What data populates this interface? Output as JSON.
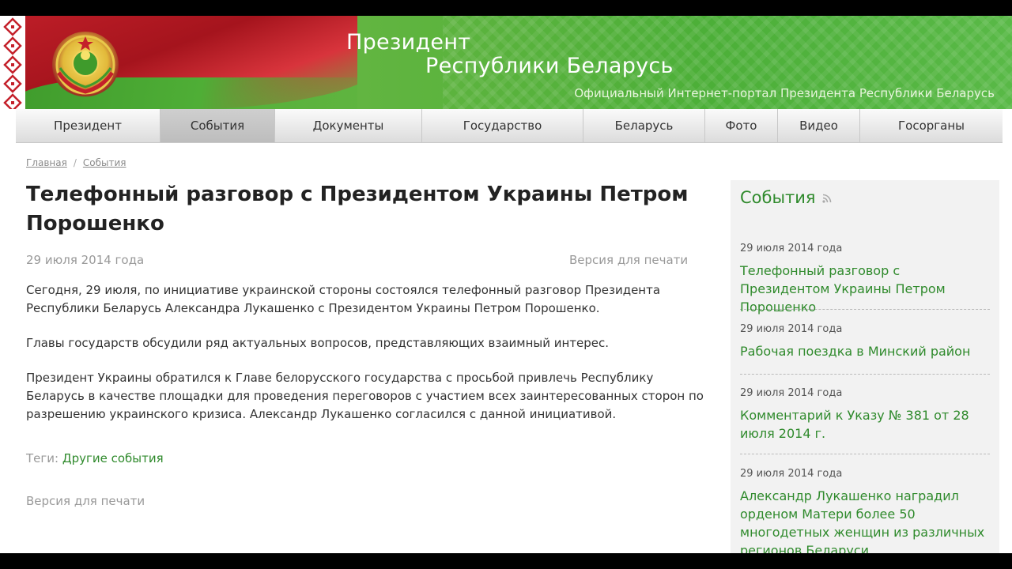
{
  "header": {
    "title_line1": "Президент",
    "title_line2": "Республики Беларусь",
    "subtitle": "Официальный Интернет-портал Президента Республики Беларусь"
  },
  "nav": {
    "items": [
      {
        "label": "Президент",
        "active": false
      },
      {
        "label": "События",
        "active": true
      },
      {
        "label": "Документы",
        "active": false
      },
      {
        "label": "Государство",
        "active": false
      },
      {
        "label": "Беларусь",
        "active": false
      },
      {
        "label": "Фото",
        "active": false
      },
      {
        "label": "Видео",
        "active": false
      },
      {
        "label": "Госорганы",
        "active": false
      }
    ]
  },
  "breadcrumb": {
    "home": "Главная",
    "separator": "/",
    "current": "События"
  },
  "article": {
    "title": "Телефонный разговор с Президентом Украины Петром Порошенко",
    "date": "29 июля 2014 года",
    "print_label": "Версия для печати",
    "paragraphs": [
      "Сегодня, 29 июля, по инициативе украинской стороны состоялся телефонный разговор Президента Республики Беларусь Александра Лукашенко с Президентом Украины Петром Порошенко.",
      "Главы государств обсудили ряд актуальных вопросов, представляющих взаимный интерес.",
      "Президент Украины обратился к Главе белорусского государства с просьбой привлечь Республику Беларусь в качестве площадки для проведения переговоров с участием всех заинтересованных сторон по разрешению украинского кризиса. Александр Лукашенко согласился с данной инициативой."
    ],
    "tags_label": "Теги:",
    "tag": "Другие события",
    "print_bottom": "Версия для печати"
  },
  "sidebar": {
    "title": "События",
    "items": [
      {
        "date": "29 июля 2014 года",
        "title": "Телефонный разговор с Президентом Украины Петром Порошенко"
      },
      {
        "date": "29 июля 2014 года",
        "title": "Рабочая поездка в Минский район"
      },
      {
        "date": "29 июля 2014 года",
        "title": "Комментарий к Указу № 381 от 28 июля 2014 г."
      },
      {
        "date": "29 июля 2014 года",
        "title": "Александр Лукашенко наградил орденом Матери более 50 многодетных женщин из различных регионов Беларуси"
      }
    ]
  },
  "colors": {
    "accent_green": "#2f8a2c",
    "header_green": "#5fb43f",
    "flag_red": "#c4202a"
  }
}
